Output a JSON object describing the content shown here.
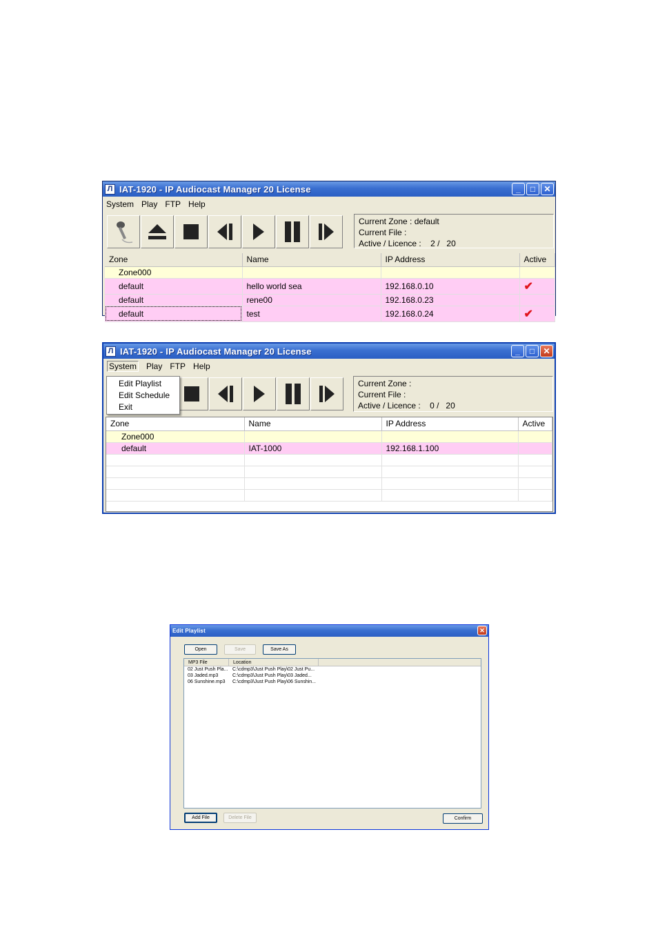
{
  "window1": {
    "title": "IAT-1920 - IP Audiocast Manager 20 License",
    "menu": [
      "System",
      "Play",
      "FTP",
      "Help"
    ],
    "info": {
      "zone_label": "Current Zone :",
      "zone_value": "default",
      "file_label": "Current File :",
      "file_value": "",
      "active_label": "Active / Licence :",
      "active_value": "2 /",
      "licence_value": "20"
    },
    "columns": [
      "Zone",
      "Name",
      "IP Address",
      "Active"
    ],
    "rows": [
      {
        "zone": "Zone000",
        "name": "",
        "ip": "",
        "active": ""
      },
      {
        "zone": "default",
        "name": "hello world sea",
        "ip": "192.168.0.10",
        "active": "✔"
      },
      {
        "zone": "default",
        "name": "rene00",
        "ip": "192.168.0.23",
        "active": ""
      },
      {
        "zone": "default",
        "name": "test",
        "ip": "192.168.0.24",
        "active": "✔"
      }
    ]
  },
  "window2": {
    "title": "IAT-1920 - IP Audiocast Manager 20 License",
    "menu": [
      "System",
      "Play",
      "FTP",
      "Help"
    ],
    "system_menu": [
      "Edit Playlist",
      "Edit Schedule",
      "Exit"
    ],
    "info": {
      "zone_label": "Current Zone :",
      "zone_value": "",
      "file_label": "Current File :",
      "file_value": "",
      "active_label": "Active / Licence :",
      "active_value": "0 /",
      "licence_value": "20"
    },
    "columns": [
      "Zone",
      "Name",
      "IP Address",
      "Active"
    ],
    "rows": [
      {
        "zone": "Zone000",
        "name": "",
        "ip": "",
        "active": ""
      },
      {
        "zone": "default",
        "name": "IAT-1000",
        "ip": "192.168.1.100",
        "active": ""
      }
    ]
  },
  "playlist": {
    "title": "Edit Playlist",
    "buttons": {
      "open": "Open",
      "save": "Save",
      "save_as": "Save As",
      "add_file": "Add File",
      "delete_file": "Delete File",
      "confirm": "Confirm"
    },
    "columns": [
      "MP3 File",
      "Location"
    ],
    "files": [
      {
        "file": "02 Just Push Pla...",
        "location": "C:\\cdmp3\\Just Push Play\\02 Just Pu..."
      },
      {
        "file": "03 Jaded.mp3",
        "location": "C:\\cdmp3\\Just Push Play\\03 Jaded..."
      },
      {
        "file": "06 Sunshine.mp3",
        "location": "C:\\cdmp3\\Just Push Play\\06 Sunshin..."
      }
    ]
  },
  "icons": [
    "microphone-icon",
    "eject-icon",
    "stop-icon",
    "previous-icon",
    "play-icon",
    "pause-icon",
    "next-icon"
  ]
}
